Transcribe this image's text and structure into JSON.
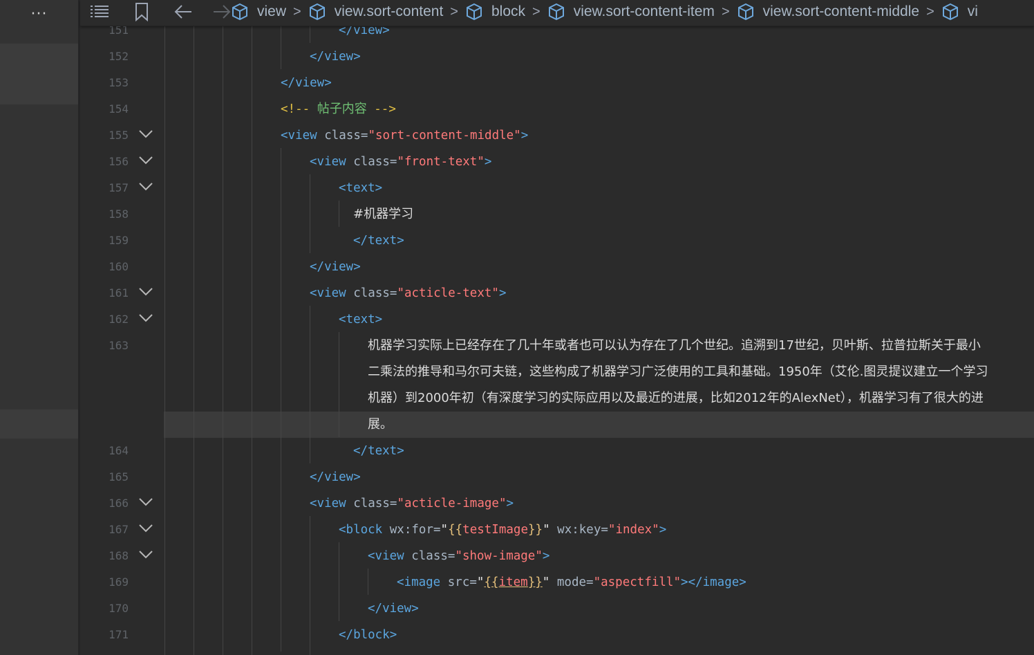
{
  "toolbar": {
    "more_label": "···",
    "icons": [
      "list-icon",
      "bookmark-icon",
      "back-arrow-icon",
      "forward-arrow-icon"
    ]
  },
  "breadcrumb": {
    "items": [
      "view",
      "view.sort-content",
      "block",
      "view.sort-content-item",
      "view.sort-content-middle",
      "vi"
    ]
  },
  "gutter": {
    "line_numbers": [
      "151",
      "152",
      "153",
      "154",
      "155",
      "156",
      "157",
      "158",
      "159",
      "160",
      "161",
      "162",
      "163",
      "164",
      "165",
      "166",
      "167",
      "168",
      "169",
      "170",
      "171"
    ],
    "foldable": [
      "155",
      "156",
      "157",
      "161",
      "162",
      "166",
      "167",
      "168"
    ]
  },
  "code": {
    "l151": "</view>",
    "l152": "</view>",
    "l153": "</view>",
    "l154_open": "<!--",
    "l154_text": "帖子内容",
    "l154_close": "-->",
    "l155_tag": "<view",
    "l155_attr": "class=",
    "l155_val": "\"sort-content-middle\"",
    "l155_end": ">",
    "l156_tag": "<view",
    "l156_attr": "class=",
    "l156_val": "\"front-text\"",
    "l156_end": ">",
    "l157": "<text>",
    "l158": "#机器学习",
    "l159": "</text>",
    "l160": "</view>",
    "l161_tag": "<view",
    "l161_attr": "class=",
    "l161_val": "\"acticle-text\"",
    "l161_end": ">",
    "l162": "<text>",
    "l163_wrap": [
      "机器学习实际上已经存在了几十年或者也可以认为存在了几个世纪。追溯到17世纪，贝叶斯、拉普拉斯关于最小",
      "二乘法的推导和马尔可夫链，这些构成了机器学习广泛使用的工具和基础。1950年（艾伦.图灵提议建立一个学习",
      "机器）到2000年初（有深度学习的实际应用以及最近的进展，比如2012年的AlexNet），机器学习有了很大的进",
      "展。"
    ],
    "l164": "</text>",
    "l165": "</view>",
    "l166_tag": "<view",
    "l166_attr": "class=",
    "l166_val": "\"acticle-image\"",
    "l166_end": ">",
    "l167_tag": "<block",
    "l167_attr1": "wx:for=",
    "l167_q1": "\"",
    "l167_b1": "{{",
    "l167_var1": "testImage",
    "l167_b2": "}}",
    "l167_q2": "\"",
    "l167_attr2": "wx:key=",
    "l167_val2": "\"index\"",
    "l167_end": ">",
    "l168_tag": "<view",
    "l168_attr": "class=",
    "l168_val": "\"show-image\"",
    "l168_end": ">",
    "l169_tag": "<image",
    "l169_attr1": "src=",
    "l169_q1": "\"",
    "l169_b1": "{{",
    "l169_var": "item",
    "l169_b2": "}}",
    "l169_q2": "\"",
    "l169_attr2": "mode=",
    "l169_val2": "\"aspectfill\"",
    "l169_end": "></image>",
    "l170": "</view>",
    "l171": "</block>"
  },
  "colors": {
    "background": "#2b2b2b",
    "tag": "#5ba6e0",
    "attribute": "#a9b7c6",
    "string": "#ff7a7a",
    "comment_delim": "#e2c044",
    "comment_text": "#6fbf73",
    "text": "#dcdcdc",
    "line_number": "#5f6368"
  }
}
